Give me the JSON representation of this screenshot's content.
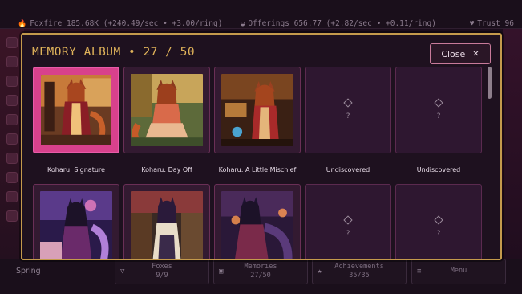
{
  "topbar": {
    "foxfire": "Foxfire 185.68K (+240.49/sec • +3.00/ring)",
    "offerings": "Offerings 656.77 (+2.82/sec • +0.11/ring)",
    "trust": "Trust 96"
  },
  "modal": {
    "title": "MEMORY ALBUM  •  27 / 50",
    "close_label": "Close"
  },
  "album": {
    "cards": [
      {
        "caption": "Koharu: Signature",
        "state": "unlocked",
        "selected": true
      },
      {
        "caption": "Koharu: Day Off",
        "state": "unlocked"
      },
      {
        "caption": "Koharu: A Little Mischief",
        "state": "unlocked"
      },
      {
        "caption": "Undiscovered",
        "state": "locked",
        "glyph": "?"
      },
      {
        "caption": "Undiscovered",
        "state": "locked",
        "glyph": "?"
      },
      {
        "caption": "",
        "state": "unlocked"
      },
      {
        "caption": "",
        "state": "unlocked"
      },
      {
        "caption": "",
        "state": "unlocked"
      },
      {
        "caption": "",
        "state": "locked",
        "glyph": "?"
      },
      {
        "caption": "",
        "state": "locked",
        "glyph": "?"
      }
    ]
  },
  "footer": {
    "season": "Spring",
    "foxes": {
      "label": "Foxes",
      "value": "9/9"
    },
    "memories": {
      "label": "Memories",
      "value": "27/50"
    },
    "achievements": {
      "label": "Achievements",
      "value": "35/35"
    },
    "menu": {
      "label": "Menu"
    }
  },
  "colors": {
    "accent_gold": "#e0b35a",
    "frame_border": "#c49a4c",
    "selected_card": "#d8418c",
    "close_border": "#c87a9a"
  }
}
